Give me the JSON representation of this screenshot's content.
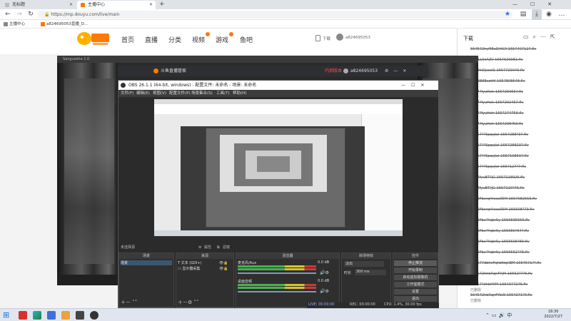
{
  "browser": {
    "tabs": [
      {
        "title": "无标题",
        "active": false
      },
      {
        "title": "主播中心",
        "active": true
      }
    ],
    "new_tab": "+",
    "url": "https://mp.douyu.com/live/main",
    "bookmarks": [
      {
        "label": "主播中心"
      },
      {
        "label": "a824695053直播_D..."
      }
    ]
  },
  "site": {
    "nav": [
      "首页",
      "直播",
      "分类",
      "视频",
      "游戏",
      "鱼吧"
    ],
    "download_app": "下载",
    "username": "a824695053"
  },
  "downloads": {
    "title": "下载",
    "items": [
      "564572hyM8aDVtGY-1657407127.flv",
      "iBrQLLSkAZV-1657629981.flv",
      "F5h3fsDJxozQ-1657729046.flv",
      "lBrx6B8ExztHl-1657808548.flv",
      "5647?fyuHeh-165729066?.flv",
      "5647?fyuHeh-1657292467.flv",
      "5647?fyuHeh-1657274756.flv",
      "5647?fyuHeh-1657298?59.flv",
      "56457??SpqcJwi-1657288?37.flv",
      "56457??SpqcJwi-1657288237.flv",
      "56457??SpqcJwi-1657198537.flv",
      "56457??SpqcJwi-1657127?7.flv",
      "5647fyuBT?jG-1657118926.flv",
      "5647fyuBT?jG-1657110?45.flv",
      "5646FbxrqrVcea05M-1657082563.flv",
      "5646FbxrqrVcea05M-165508?73.flv",
      "5646Fbx?Yqbr6y-1656835556.flv",
      "5646Fbx?Yqbr6y-165580?64?.flv",
      "5646Fbx?Yqbr6y-1656608?89.flv",
      "5646Fbx?Yqbr6y-1656562?78.flv",
      "564577dbhnFqhbNqCBM-1654571??.flv",
      "564572hhbRqnFYjM-16562?7?6.flv",
      "56457?dhbHYM-1654377246.flv",
      "564572hbRqnFYbW-1654271?9.flv"
    ],
    "subtitles": [
      "已删除",
      "已删除"
    ]
  },
  "stream": {
    "window_title": "Sanguosha 1.0"
  },
  "assistant": {
    "title": "斗鱼直播管家",
    "status": "内测版本",
    "user": "a824695053"
  },
  "obs": {
    "title": "OBS 26.1.1 (64-bit, windows) - 配置文件: 未命名 - 场景: 未命名",
    "menu": [
      "文件(F)",
      "编辑(E)",
      "视图(V)",
      "配置文件(P)",
      "场景集合(S)",
      "工具(T)",
      "帮助(H)"
    ],
    "preview_toggle": "未选择源",
    "props_btn": "属性",
    "filters_btn": "滤镜",
    "docks": {
      "scenes": {
        "title": "场景",
        "items": [
          "场景"
        ]
      },
      "sources": {
        "title": "来源",
        "items": [
          "文本 (GDI+)",
          "显示器采集"
        ]
      },
      "mixer": {
        "title": "混音器",
        "channels": [
          {
            "name": "麦克风/Aux",
            "db": "0.0 dB"
          },
          {
            "name": "桌面音频",
            "db": "0.0 dB"
          }
        ]
      },
      "transitions": {
        "title": "转场特效",
        "type": "淡出",
        "duration_label": "时长",
        "duration": "300 ms"
      },
      "controls": {
        "title": "控件",
        "buttons": [
          "停止推流",
          "开始录制",
          "启动虚拟摄像机",
          "工作室模式",
          "设置",
          "退出"
        ]
      }
    },
    "status": {
      "live": "LIVE: 00:00:00",
      "rec": "REC: 00:00:00",
      "cpu": "CPU: 1.4%, 30.00 fps"
    }
  },
  "taskbar": {
    "time": "18:30",
    "date": "2022/7/27"
  },
  "colors": {
    "accent": "#ff7a00",
    "obs_bg": "#2b2b2b",
    "meter_green": "#4caf50",
    "meter_yellow": "#d8c22c",
    "meter_red": "#c83a3a"
  }
}
